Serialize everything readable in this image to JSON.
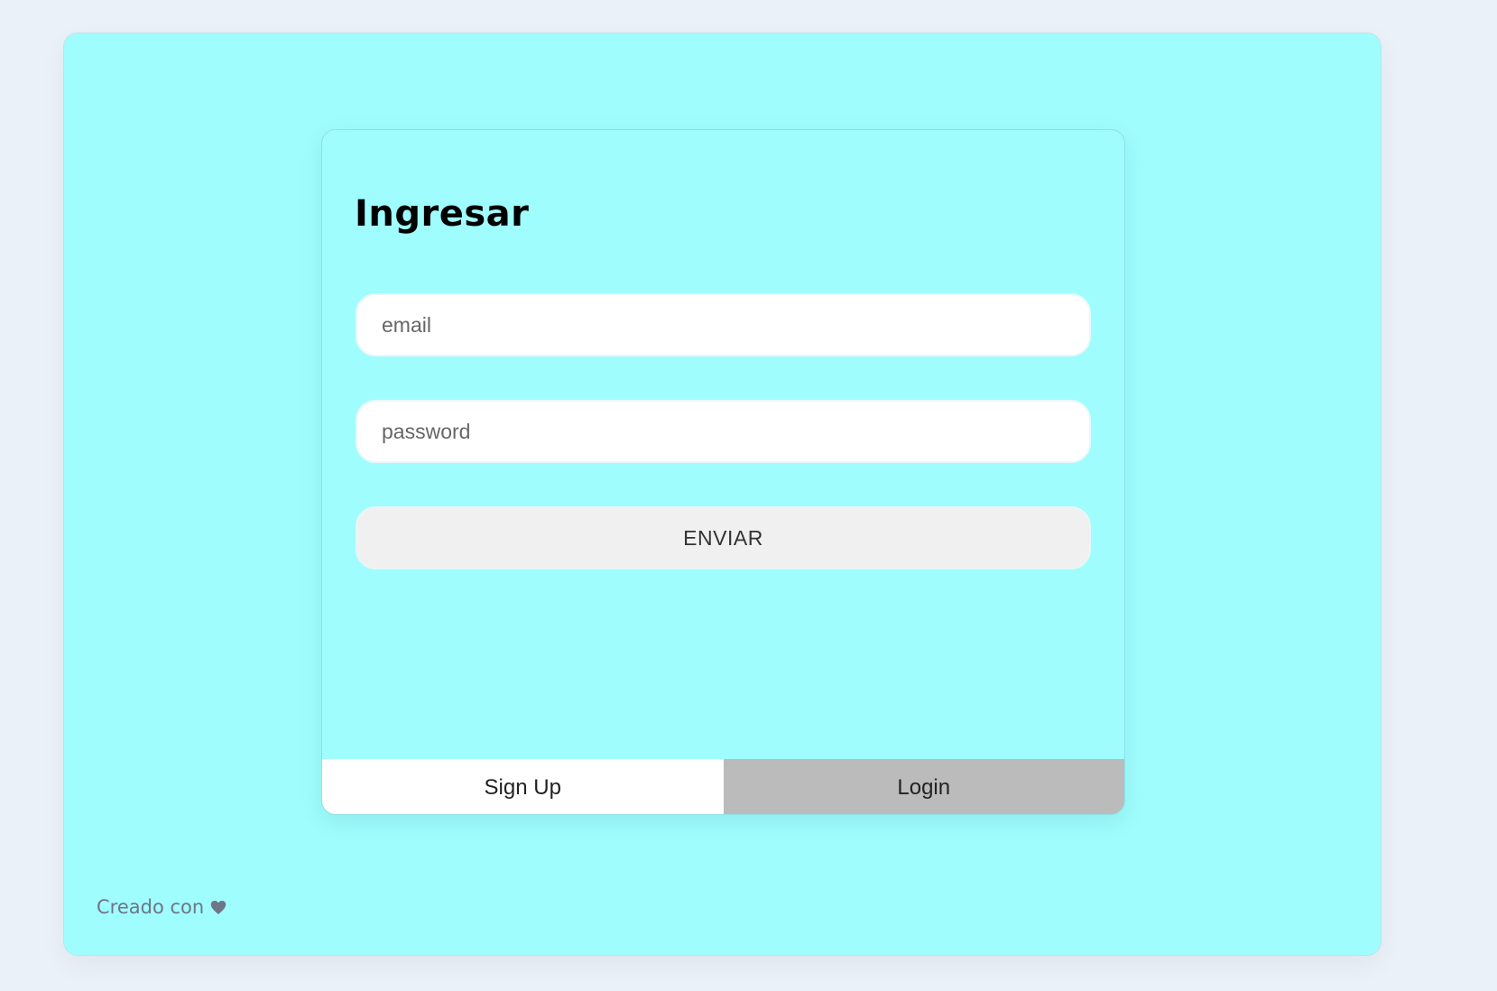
{
  "auth_card": {
    "title": "Ingresar",
    "email_placeholder": "email",
    "password_placeholder": "password",
    "submit_label": "ENVIAR"
  },
  "tabs": [
    {
      "label": "Sign Up"
    },
    {
      "label": "Login"
    }
  ],
  "footer": {
    "text": "Creado con",
    "icon": "heart-icon"
  },
  "colors": {
    "page_background": "#eaf1f8",
    "panel_background": "#9ffdfd",
    "input_background": "#ffffff",
    "button_background": "#f0f0f0",
    "signup_tab_background": "#ffffff",
    "login_tab_background": "#bbbbbb",
    "footer_text": "#6f7587"
  }
}
